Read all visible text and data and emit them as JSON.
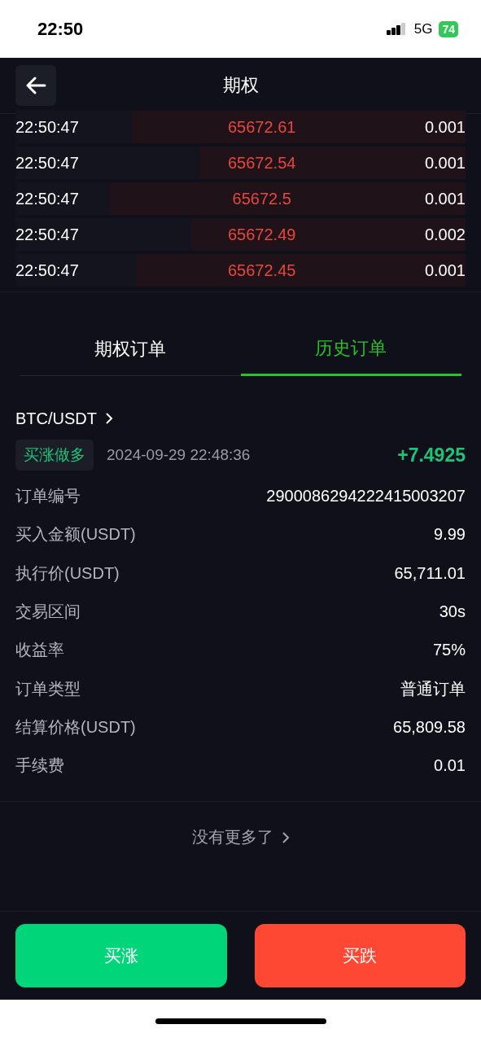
{
  "status_bar": {
    "time": "22:50",
    "network": "5G",
    "battery": "74"
  },
  "header": {
    "title": "期权"
  },
  "trades": [
    {
      "time": "22:50:47",
      "price": "65672.61",
      "amount": "0.001",
      "level": 0.74
    },
    {
      "time": "22:50:47",
      "price": "65672.54",
      "amount": "0.001",
      "level": 0.59
    },
    {
      "time": "22:50:47",
      "price": "65672.5",
      "amount": "0.001",
      "level": 0.79
    },
    {
      "time": "22:50:47",
      "price": "65672.49",
      "amount": "0.002",
      "level": 0.61
    },
    {
      "time": "22:50:47",
      "price": "65672.45",
      "amount": "0.001",
      "level": 0.73
    }
  ],
  "tabs": [
    {
      "label": "期权订单",
      "selected": false
    },
    {
      "label": "历史订单",
      "selected": true
    }
  ],
  "order": {
    "pair": "BTC/USDT",
    "direction": "买涨做多",
    "datetime": "2024-09-29 22:48:36",
    "profit": "+7.4925",
    "fields": [
      {
        "label": "订单编号",
        "value": "2900086294222415003207"
      },
      {
        "label": "买入金额(USDT)",
        "value": "9.99"
      },
      {
        "label": "执行价(USDT)",
        "value": "65,711.01"
      },
      {
        "label": "交易区间",
        "value": "30s"
      },
      {
        "label": "收益率",
        "value": "75%"
      },
      {
        "label": "订单类型",
        "value": "普通订单"
      },
      {
        "label": "结算价格(USDT)",
        "value": "65,809.58"
      },
      {
        "label": "手续费",
        "value": "0.01"
      }
    ]
  },
  "no_more": "没有更多了",
  "buttons": [
    {
      "label": "买涨",
      "kind": "up"
    },
    {
      "label": "买跌",
      "kind": "down"
    }
  ]
}
